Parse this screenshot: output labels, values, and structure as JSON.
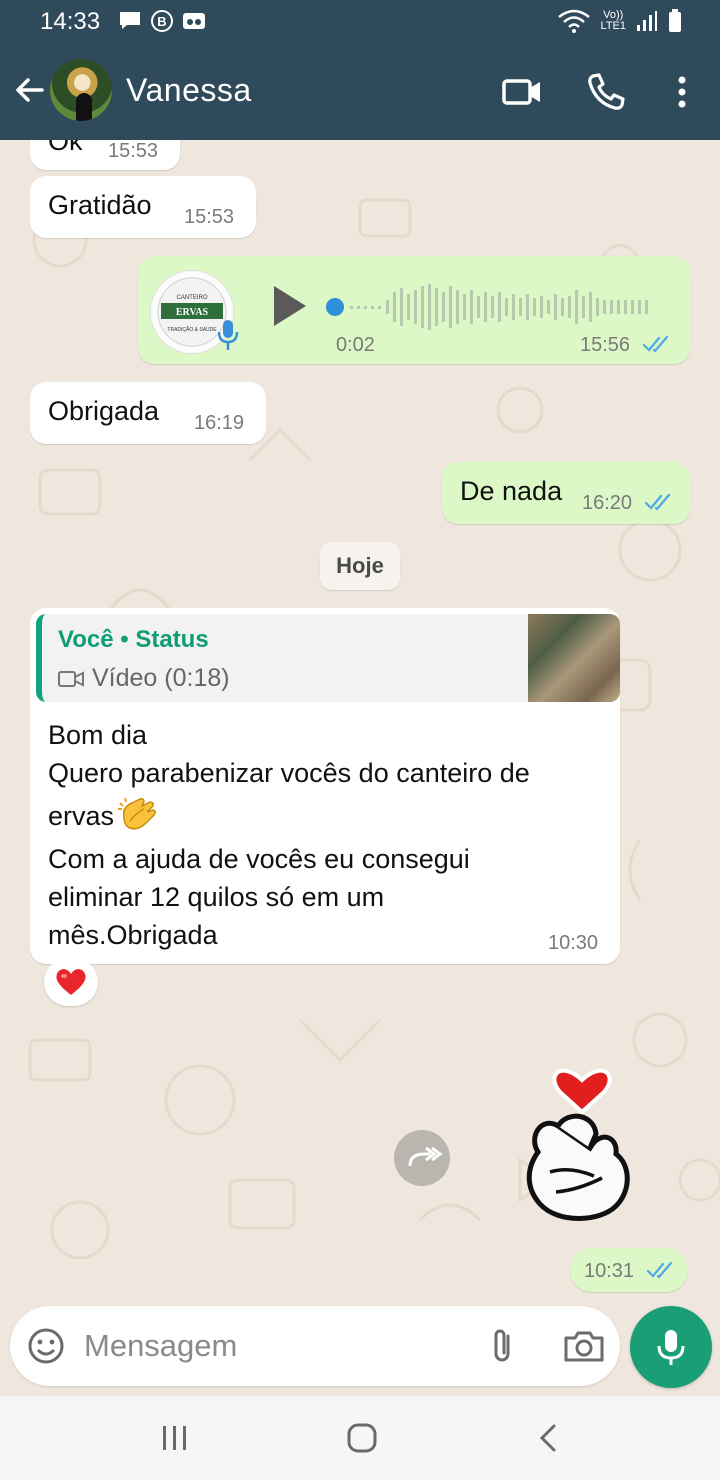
{
  "status_bar": {
    "time": "14:33",
    "notification_icons": [
      "message-icon",
      "b-icon",
      "voicemail-icon"
    ],
    "right_icons": [
      "wifi-icon",
      "volte-icon",
      "signal-icon",
      "battery-icon"
    ],
    "network_label_1": "Vo))",
    "network_label_2": "LTE1"
  },
  "header": {
    "contact_name": "Vanessa",
    "actions": [
      "video-call-icon",
      "phone-call-icon",
      "more-options-icon"
    ]
  },
  "messages": [
    {
      "id": "m1",
      "direction": "in",
      "text": "Ok",
      "time": "15:53"
    },
    {
      "id": "m2",
      "direction": "in",
      "text": "Gratidão",
      "time": "15:53"
    },
    {
      "id": "m3",
      "direction": "out",
      "type": "audio",
      "duration": "0:02",
      "time": "15:56",
      "status": "read",
      "logo_text": "CANTEIRO DE ERVAS",
      "logo_caption": "TRADIÇÃO & SAÚDE"
    },
    {
      "id": "m4",
      "direction": "in",
      "text": "Obrigada",
      "time": "16:19"
    },
    {
      "id": "m5",
      "direction": "out",
      "text": "De nada",
      "time": "16:20",
      "status": "read"
    }
  ],
  "date_separator": "Hoje",
  "status_reply": {
    "quoted_author": "Você",
    "quoted_separator": " • ",
    "quoted_source": "Status",
    "quoted_media": "Vídeo (0:18)",
    "lines": [
      "Bom dia",
      "Quero parabenizar vocês do canteiro de",
      "ervas",
      "Com a ajuda de vocês eu consegui",
      "eliminar 12 quilos só em um",
      "mês.Obrigada"
    ],
    "time": "10:30",
    "reaction": "heart-reaction-icon"
  },
  "sticker_message": {
    "sticker": "finger-heart-sticker",
    "time": "10:31",
    "status": "read"
  },
  "composer": {
    "placeholder": "Mensagem"
  },
  "colors": {
    "header_bg": "#2f4a5a",
    "chat_bg": "#efe7dd",
    "outgoing_bubble": "#dcf8c6",
    "incoming_bubble": "#ffffff",
    "read_ticks": "#4fa8e8",
    "accent_green": "#1a9e75"
  }
}
